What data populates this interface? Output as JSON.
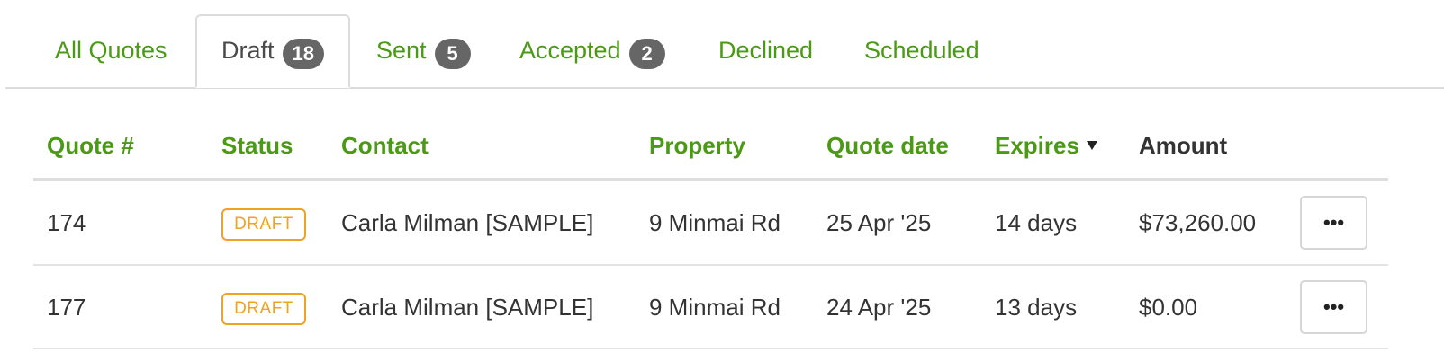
{
  "tabs": [
    {
      "label": "All Quotes"
    },
    {
      "label": "Draft",
      "count": "18"
    },
    {
      "label": "Sent",
      "count": "5"
    },
    {
      "label": "Accepted",
      "count": "2"
    },
    {
      "label": "Declined"
    },
    {
      "label": "Scheduled"
    }
  ],
  "active_tab": "Draft",
  "columns": {
    "quote_no": "Quote #",
    "status": "Status",
    "contact": "Contact",
    "property": "Property",
    "quote_date": "Quote date",
    "expires": "Expires",
    "amount": "Amount"
  },
  "sort": {
    "column": "Expires",
    "direction": "descending",
    "icon": "caret-down-icon"
  },
  "rows": [
    {
      "quote_no": "174",
      "status": "DRAFT",
      "contact": "Carla Milman [SAMPLE]",
      "property": "9 Minmai Rd",
      "quote_date": "25 Apr '25",
      "expires": "14 days",
      "amount": "$73,260.00",
      "menu": "•••"
    },
    {
      "quote_no": "177",
      "status": "DRAFT",
      "contact": "Carla Milman [SAMPLE]",
      "property": "9 Minmai Rd",
      "quote_date": "24 Apr '25",
      "expires": "13 days",
      "amount": "$0.00",
      "menu": "•••"
    }
  ],
  "colors": {
    "link_green": "#4a9a14",
    "draft_orange": "#f0a31e",
    "badge_gray": "#666666"
  }
}
